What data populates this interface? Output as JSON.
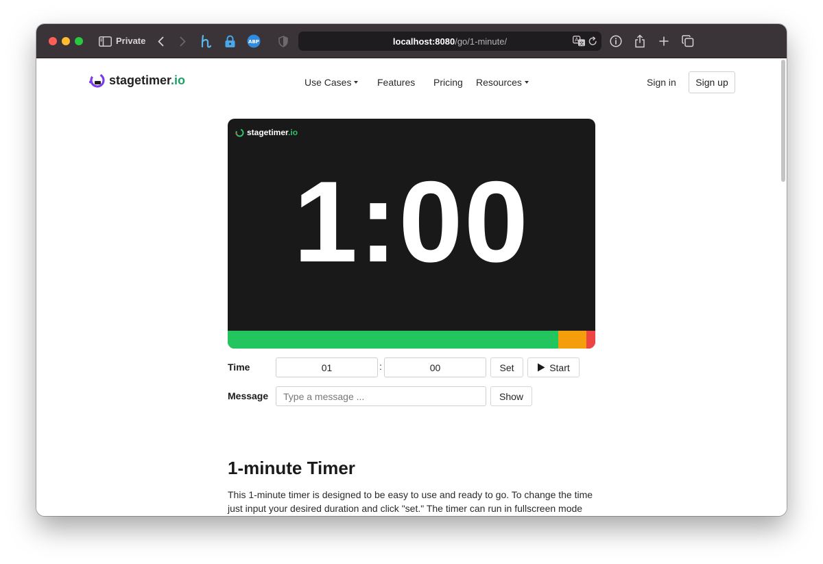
{
  "browser": {
    "private_label": "Private",
    "url_host": "localhost:8080",
    "url_path": "/go/1-minute/",
    "icons": [
      "sidebar-icon",
      "back-icon",
      "forward-icon",
      "honey-extension-icon",
      "lock-icon",
      "adblock-icon",
      "shield-icon",
      "translate-icon",
      "reload-icon",
      "info-icon",
      "share-icon",
      "new-tab-icon",
      "tabs-overview-icon"
    ]
  },
  "nav": {
    "brand_main": "stagetimer",
    "brand_tld": ".io",
    "links": [
      "Use Cases",
      "Features",
      "Pricing",
      "Resources"
    ],
    "sign_in": "Sign in",
    "sign_up": "Sign up"
  },
  "timer": {
    "brand_main": "stagetimer",
    "brand_tld": ".io",
    "display": "1:00",
    "progress": [
      {
        "color": "#22c55e",
        "fraction": 0.9
      },
      {
        "color": "#f59e0b",
        "fraction": 0.075
      },
      {
        "color": "#ef4444",
        "fraction": 0.025
      }
    ]
  },
  "controls": {
    "time_label": "Time",
    "minutes": "01",
    "separator": ":",
    "seconds": "00",
    "set_label": "Set",
    "start_label": "Start",
    "message_label": "Message",
    "message_placeholder": "Type a message ...",
    "show_label": "Show"
  },
  "article": {
    "title": "1-minute Timer",
    "body_line1": "This 1-minute timer is designed to be easy to use and ready to go. To change the time",
    "body_line2": "just input your desired duration and click \"set.\" The timer can run in fullscreen mode"
  },
  "colors": {
    "accent": "#1f9e6a",
    "timer_bg": "#1a191a",
    "titlebar": "#3a3439"
  }
}
